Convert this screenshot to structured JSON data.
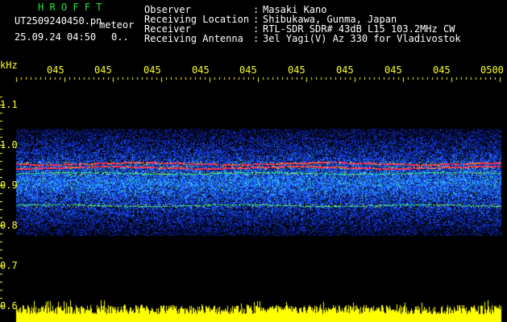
{
  "app": {
    "logo_text": "H R O F F T",
    "file_name": "UT2509240450.pn",
    "mode_label": "meteor",
    "date_time": "25.09.24 04:50",
    "count_value": "0.."
  },
  "info": {
    "labels": [
      "Observer",
      "Receiving Location",
      "Receiver",
      "Receiving Antenna"
    ],
    "separator": ":",
    "values": [
      "Masaki Kano",
      "Shibukawa, Gunma, Japan",
      "RTL-SDR SDR# 43dB L15 103.2MHz CW",
      "3el Yagi(V) Az 330 for Vladivostok"
    ]
  },
  "chart_data": {
    "type": "heatmap",
    "ylabel": "kHz",
    "y_ticks": [
      "1.1",
      "1.0",
      "0.9",
      "0.8",
      "0.7",
      "0.6"
    ],
    "y_values": [
      1.1,
      1.0,
      0.9,
      0.8,
      0.7,
      0.6
    ],
    "ylim": [
      0.6,
      1.1
    ],
    "x_ticks": [
      "045",
      "045",
      "045",
      "045",
      "045",
      "045",
      "045",
      "045",
      "045",
      "0500"
    ],
    "noise_band": [
      0.775,
      1.04
    ],
    "signal_lines": [
      {
        "freq": 0.955,
        "color": "#ff2a4a"
      },
      {
        "freq": 0.945,
        "color": "#ff2a4a"
      },
      {
        "freq": 0.93,
        "color": "#28e07a"
      },
      {
        "freq": 0.85,
        "color": "#28e07a"
      }
    ],
    "power_bar_color": "#ffff00"
  }
}
